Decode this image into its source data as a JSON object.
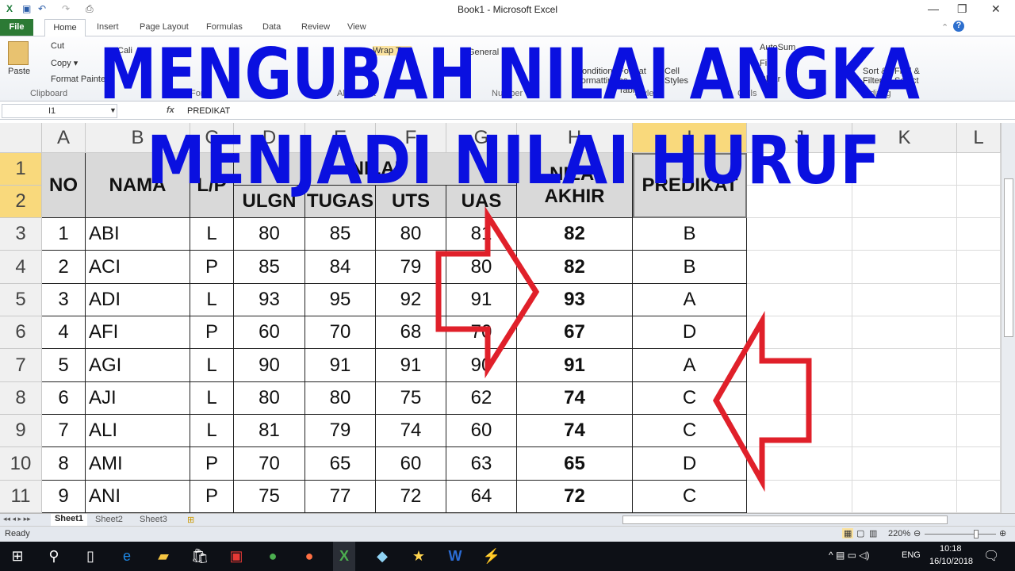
{
  "window": {
    "title": "Book1  -  Microsoft Excel",
    "minimize": "—",
    "restore": "❐",
    "close": "✕"
  },
  "ribbon_tabs": [
    "File",
    "Home",
    "Insert",
    "Page Layout",
    "Formulas",
    "Data",
    "Review",
    "View"
  ],
  "ribbon": {
    "paste": "Paste",
    "cut": "Cut",
    "copy": "Copy ▾",
    "format_painter": "Format Painter",
    "clipboard": "Clipboard",
    "font_name": "Cali",
    "wrap_text": "Wrap Text",
    "number_format": "General",
    "number_group": "Number",
    "conditional": "Conditional Formatting",
    "format_table": "Format as Table",
    "cell_styles": "Cell Styles",
    "styles": "Styles",
    "cells": "Cells",
    "autosum": "AutoSum",
    "fill": "Fill",
    "clear": "Clear",
    "sort_filter": "Sort & Filter",
    "find_select": "Find & Select",
    "editing": "Editing",
    "alignment": "Alignment",
    "font": "Font"
  },
  "formula_bar": {
    "name_box": "I1",
    "fx": "fx",
    "value": "PREDIKAT"
  },
  "columns": [
    "A",
    "B",
    "C",
    "D",
    "E",
    "F",
    "G",
    "H",
    "I",
    "J",
    "K",
    "L"
  ],
  "rows": [
    "1",
    "2",
    "3",
    "4",
    "5",
    "6",
    "7",
    "8",
    "9",
    "10",
    "11"
  ],
  "headers": {
    "no": "NO",
    "nama": "NAMA",
    "lp": "L/P",
    "nilai": "NILAI",
    "ulgn": "ULGN",
    "tugas": "TUGAS",
    "uts": "UTS",
    "uas": "UAS",
    "nilai_akhir": "NILAI AKHIR",
    "nilai_akhir_2": "AKHIR",
    "predikat": "PREDIKAT"
  },
  "table": [
    [
      "1",
      "ABI",
      "L",
      "80",
      "85",
      "80",
      "81",
      "82",
      "B"
    ],
    [
      "2",
      "ACI",
      "P",
      "85",
      "84",
      "79",
      "80",
      "82",
      "B"
    ],
    [
      "3",
      "ADI",
      "L",
      "93",
      "95",
      "92",
      "91",
      "93",
      "A"
    ],
    [
      "4",
      "AFI",
      "P",
      "60",
      "70",
      "68",
      "70",
      "67",
      "D"
    ],
    [
      "5",
      "AGI",
      "L",
      "90",
      "91",
      "91",
      "90",
      "91",
      "A"
    ],
    [
      "6",
      "AJI",
      "L",
      "80",
      "80",
      "75",
      "62",
      "74",
      "C"
    ],
    [
      "7",
      "ALI",
      "L",
      "81",
      "79",
      "74",
      "60",
      "74",
      "C"
    ],
    [
      "8",
      "AMI",
      "P",
      "70",
      "65",
      "60",
      "63",
      "65",
      "D"
    ],
    [
      "9",
      "ANI",
      "P",
      "75",
      "77",
      "72",
      "64",
      "72",
      "C"
    ]
  ],
  "sheets": [
    "Sheet1",
    "Sheet2",
    "Sheet3"
  ],
  "status": {
    "ready": "Ready",
    "zoom": "220%"
  },
  "taskbar": {
    "lang": "ENG",
    "time": "10:18",
    "date": "16/10/2018"
  },
  "overlay": {
    "line1": "MENGUBAH NILAI ANGKA",
    "line2": "MENJADI NILAI HURUF",
    "text_color": "#0a10e0",
    "arrow_color": "#e0202a"
  }
}
